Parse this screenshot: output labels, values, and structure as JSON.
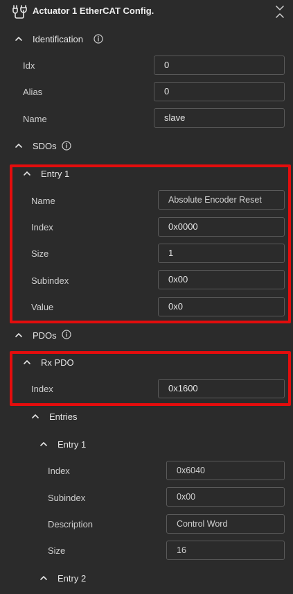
{
  "header": {
    "title": "Actuator 1 EtherCAT Config.",
    "plug_icon": "plug-icon",
    "collapse_icon": "collapse-all-icon"
  },
  "identification": {
    "label": "Identification",
    "fields": [
      {
        "label": "Idx",
        "value": "0"
      },
      {
        "label": "Alias",
        "value": "0"
      },
      {
        "label": "Name",
        "value": "slave"
      }
    ]
  },
  "sdos": {
    "label": "SDOs",
    "entry": {
      "label": "Entry 1",
      "fields": [
        {
          "label": "Name",
          "value": "Absolute Encoder Reset"
        },
        {
          "label": "Index",
          "value": "0x0000"
        },
        {
          "label": "Size",
          "value": "1"
        },
        {
          "label": "Subindex",
          "value": "0x00"
        },
        {
          "label": "Value",
          "value": "0x0"
        }
      ]
    }
  },
  "pdos": {
    "label": "PDOs",
    "rx": {
      "label": "Rx PDO",
      "index_label": "Index",
      "index_value": "0x1600",
      "entries": {
        "label": "Entries",
        "entry1": {
          "label": "Entry 1",
          "fields": [
            {
              "label": "Index",
              "value": "0x6040"
            },
            {
              "label": "Subindex",
              "value": "0x00"
            },
            {
              "label": "Description",
              "value": "Control Word"
            },
            {
              "label": "Size",
              "value": "16"
            }
          ]
        },
        "entry2": {
          "label": "Entry 2"
        }
      }
    }
  },
  "colors": {
    "background": "#2b2b2b",
    "highlight": "#e30d0d",
    "field_border": "#5a5a5a",
    "text": "#e6e6e6"
  }
}
